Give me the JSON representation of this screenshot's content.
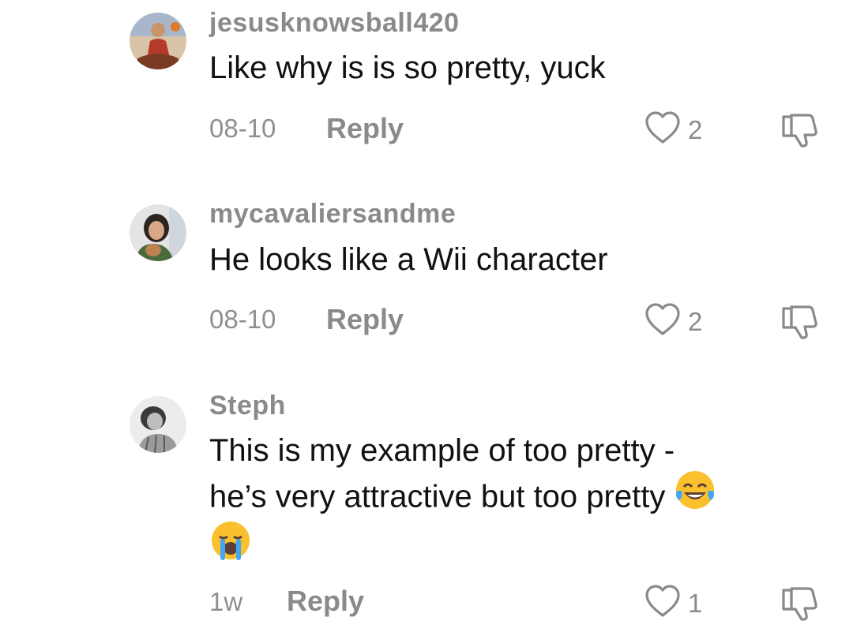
{
  "comments": [
    {
      "username": "jesusknowsball420",
      "text": "Like why is is so pretty, yuck",
      "date": "08-10",
      "reply_label": "Reply",
      "likes": "2",
      "avatar_icon": "avatar-image"
    },
    {
      "username": "mycavaliersandme",
      "text": "He looks like a Wii character",
      "date": "08-10",
      "reply_label": "Reply",
      "likes": "2",
      "avatar_icon": "avatar-image"
    },
    {
      "username": "Steph",
      "text_line1": "This is my example of too pretty -",
      "text_line2": "he’s very attractive but too pretty",
      "emojis": [
        "face-with-tears-of-joy",
        "loudly-crying-face"
      ],
      "date": "1w",
      "reply_label": "Reply",
      "likes": "1",
      "avatar_icon": "avatar-image"
    }
  ],
  "icons": {
    "like": "heart-outline-icon",
    "dislike": "thumbs-down-outline-icon"
  },
  "colors": {
    "username": "#8a8a8a",
    "text": "#111111",
    "meta": "#8f8f8f"
  }
}
